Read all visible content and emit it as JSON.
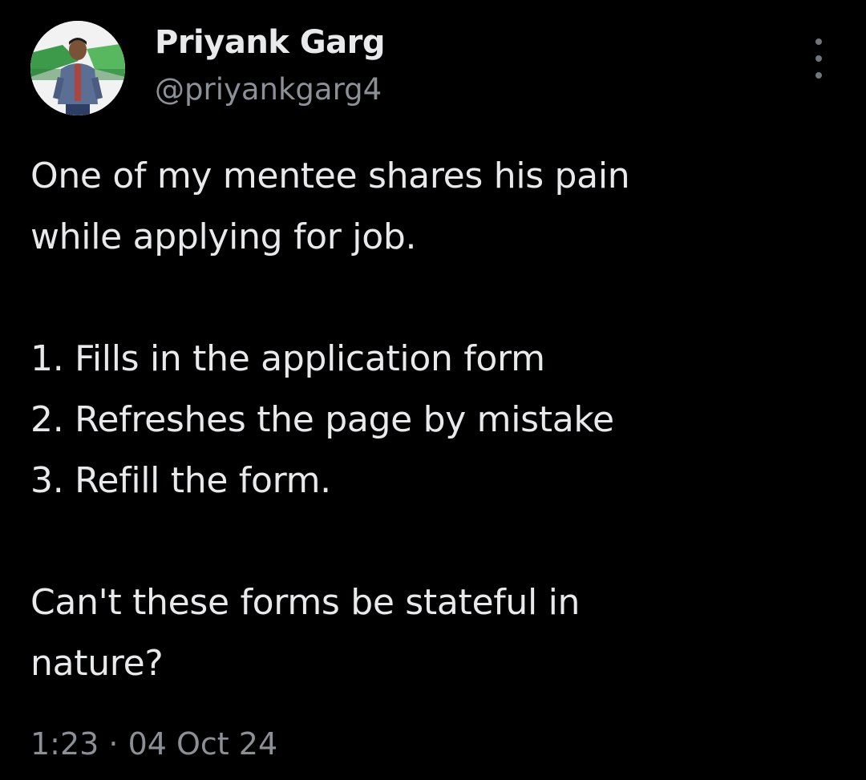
{
  "author": {
    "display_name": "Priyank Garg",
    "handle": "@priyankgarg4",
    "avatar_icon": "profile-photo-icon"
  },
  "menu": {
    "icon": "more-vertical-icon"
  },
  "tweet": {
    "lines": [
      "One of my mentee shares his pain",
      "while applying for job.",
      "1. Fills in the application form",
      "2. Refreshes the page by mistake",
      "3. Refill the form.",
      "Can't these forms be stateful in",
      "nature?"
    ],
    "timestamp": "1:23 · 04 Oct 24"
  },
  "colors": {
    "background": "#000000",
    "primary_text": "#e7e9ea",
    "secondary_text": "#8b9096"
  }
}
